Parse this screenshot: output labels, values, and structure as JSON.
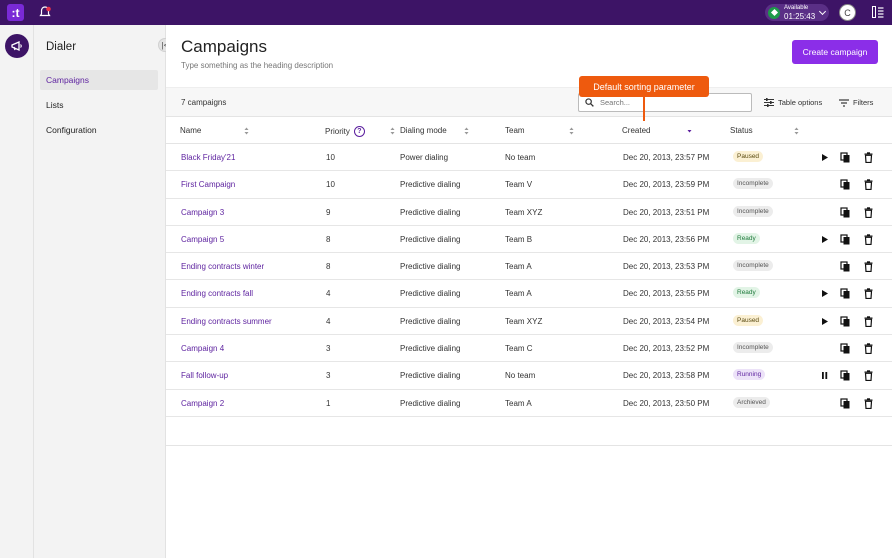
{
  "topbar": {
    "logo_text": ":t",
    "status_label": "Available",
    "status_time": "01:25:43",
    "user_initial": "C"
  },
  "sidebar": {
    "title": "Dialer",
    "items": [
      {
        "label": "Campaigns"
      },
      {
        "label": "Lists"
      },
      {
        "label": "Configuration"
      }
    ]
  },
  "page": {
    "title": "Campaigns",
    "description": "Type something as the heading description",
    "create_button": "Create campaign"
  },
  "toolbar": {
    "count": "7 campaigns",
    "search_placeholder": "Search...",
    "table_options": "Table options",
    "filters": "Filters"
  },
  "tooltip": "Default sorting parameter",
  "columns": {
    "name": "Name",
    "priority": "Priority",
    "mode": "Dialing mode",
    "team": "Team",
    "created": "Created",
    "status": "Status"
  },
  "rows": [
    {
      "name": "Black Friday'21",
      "priority": "10",
      "mode": "Power dialing",
      "team": "No team",
      "created": "Dec 20, 2013, 23:57 PM",
      "status": "Paused",
      "action": "play"
    },
    {
      "name": "First Campaign",
      "priority": "10",
      "mode": "Predictive dialing",
      "team": "Team V",
      "created": "Dec 20, 2013, 23:59 PM",
      "status": "Incomplete",
      "action": ""
    },
    {
      "name": "Campaign 3",
      "priority": "9",
      "mode": "Predictive dialing",
      "team": "Team XYZ",
      "created": "Dec 20, 2013, 23:51 PM",
      "status": "Incomplete",
      "action": ""
    },
    {
      "name": "Campaign 5",
      "priority": "8",
      "mode": "Predictive dialing",
      "team": "Team B",
      "created": "Dec 20, 2013, 23:56 PM",
      "status": "Ready",
      "action": "play"
    },
    {
      "name": "Ending contracts winter",
      "priority": "8",
      "mode": "Predictive dialing",
      "team": "Team A",
      "created": "Dec 20, 2013, 23:53 PM",
      "status": "Incomplete",
      "action": ""
    },
    {
      "name": "Ending contracts fall",
      "priority": "4",
      "mode": "Predictive dialing",
      "team": "Team A",
      "created": "Dec 20, 2013, 23:55 PM",
      "status": "Ready",
      "action": "play"
    },
    {
      "name": "Ending contracts summer",
      "priority": "4",
      "mode": "Predictive dialing",
      "team": "Team XYZ",
      "created": "Dec 20, 2013, 23:54 PM",
      "status": "Paused",
      "action": "play"
    },
    {
      "name": "Campaign 4",
      "priority": "3",
      "mode": "Predictive dialing",
      "team": "Team C",
      "created": "Dec 20, 2013, 23:52 PM",
      "status": "Incomplete",
      "action": ""
    },
    {
      "name": "Fall follow-up",
      "priority": "3",
      "mode": "Predictive dialing",
      "team": "No team",
      "created": "Dec 20, 2013, 23:58 PM",
      "status": "Running",
      "action": "pause"
    },
    {
      "name": "Campaign 2",
      "priority": "1",
      "mode": "Predictive dialing",
      "team": "Team A",
      "created": "Dec 20, 2013, 23:50 PM",
      "status": "Archieved",
      "action": ""
    }
  ],
  "colors": {
    "brand_dark": "#3d1466",
    "accent": "#8b2ee8",
    "tooltip": "#ee5a0e"
  }
}
